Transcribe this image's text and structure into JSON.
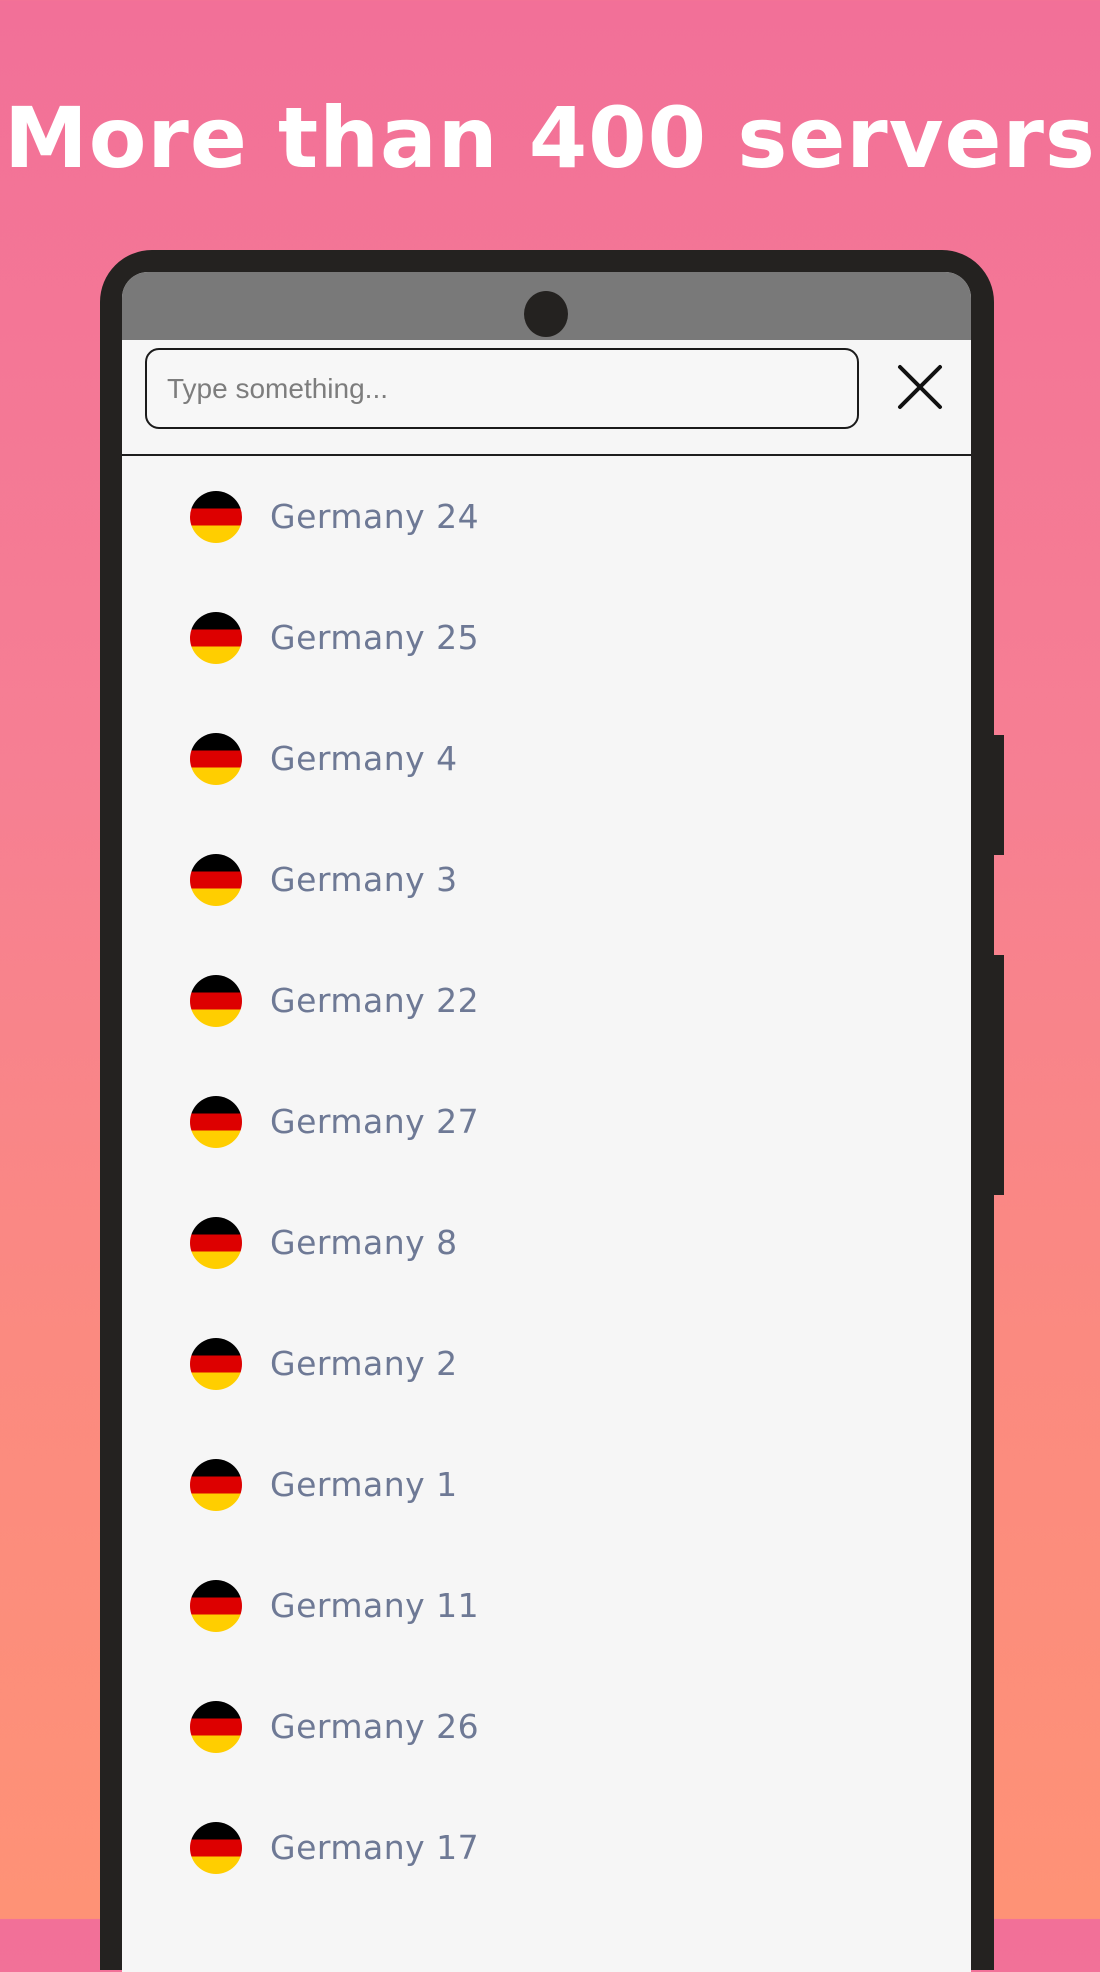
{
  "headline": "More than 400 servers",
  "search": {
    "placeholder": "Type something...",
    "value": ""
  },
  "close_icon": "close-icon",
  "servers": [
    {
      "country": "Germany",
      "label": "Germany 24",
      "flag": "flag-germany-icon"
    },
    {
      "country": "Germany",
      "label": "Germany 25",
      "flag": "flag-germany-icon"
    },
    {
      "country": "Germany",
      "label": "Germany 4",
      "flag": "flag-germany-icon"
    },
    {
      "country": "Germany",
      "label": "Germany 3",
      "flag": "flag-germany-icon"
    },
    {
      "country": "Germany",
      "label": "Germany 22",
      "flag": "flag-germany-icon"
    },
    {
      "country": "Germany",
      "label": "Germany 27",
      "flag": "flag-germany-icon"
    },
    {
      "country": "Germany",
      "label": "Germany 8",
      "flag": "flag-germany-icon"
    },
    {
      "country": "Germany",
      "label": "Germany 2",
      "flag": "flag-germany-icon"
    },
    {
      "country": "Germany",
      "label": "Germany 1",
      "flag": "flag-germany-icon"
    },
    {
      "country": "Germany",
      "label": "Germany 11",
      "flag": "flag-germany-icon"
    },
    {
      "country": "Germany",
      "label": "Germany 26",
      "flag": "flag-germany-icon"
    },
    {
      "country": "Germany",
      "label": "Germany 17",
      "flag": "flag-germany-icon"
    }
  ],
  "colors": {
    "background_top": "#f27098",
    "background_bottom": "#fe9276",
    "phone_frame": "#242220",
    "statusbar": "#797979",
    "screen": "#f6f6f6",
    "server_label": "#6e7995",
    "flag_black": "#000000",
    "flag_red": "#dd0000",
    "flag_gold": "#ffce00"
  }
}
